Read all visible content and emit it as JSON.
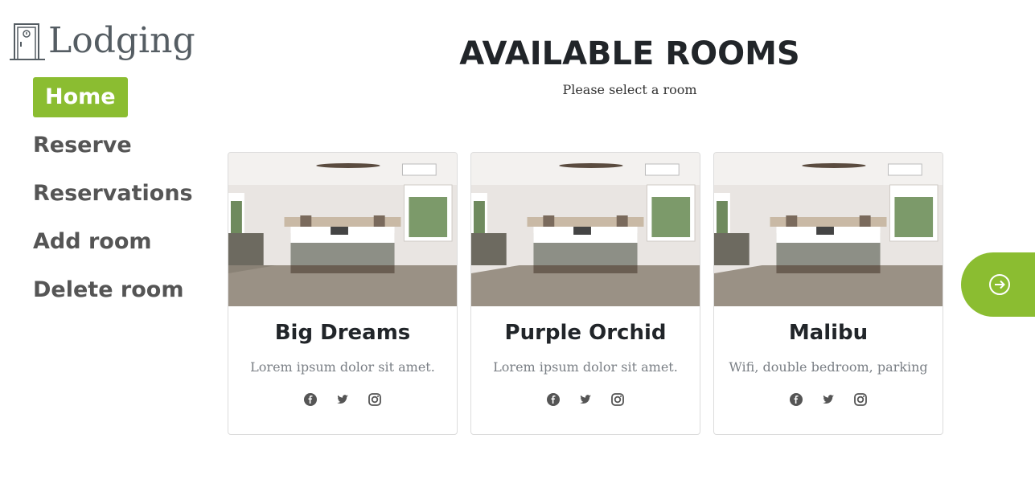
{
  "logo": {
    "text": "Lodging",
    "icon": "door-icon"
  },
  "nav": {
    "items": [
      {
        "label": "Home",
        "active": true
      },
      {
        "label": "Reserve"
      },
      {
        "label": "Reservations"
      },
      {
        "label": "Add room"
      },
      {
        "label": "Delete room"
      }
    ]
  },
  "main": {
    "title": "AVAILABLE ROOMS",
    "subtitle": "Please select a room"
  },
  "rooms": [
    {
      "name": "Big Dreams",
      "description": "Lorem ipsum dolor sit amet.",
      "socials": [
        "facebook-icon",
        "twitter-icon",
        "instagram-icon"
      ]
    },
    {
      "name": "Purple Orchid",
      "description": "Lorem ipsum dolor sit amet.",
      "socials": [
        "facebook-icon",
        "twitter-icon",
        "instagram-icon"
      ]
    },
    {
      "name": "Malibu",
      "description": "Wifi, double bedroom, parking",
      "socials": [
        "facebook-icon",
        "twitter-icon",
        "instagram-icon"
      ]
    }
  ],
  "next_button": {
    "icon": "arrow-right-circle-icon"
  },
  "colors": {
    "accent": "#8bbd31",
    "nav_text": "#555555",
    "title": "#212529",
    "muted": "#7a7f85"
  }
}
